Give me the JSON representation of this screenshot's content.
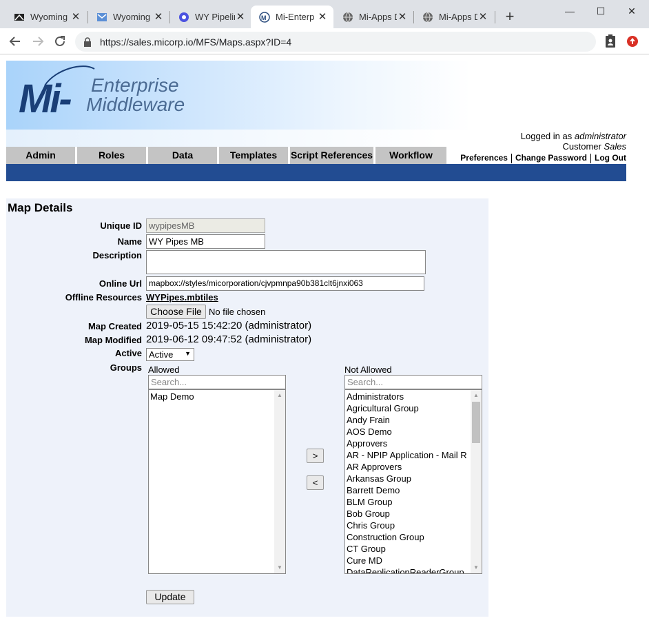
{
  "browser": {
    "tabs": [
      {
        "label": "Wyoming",
        "icon": "wyoming-favicon",
        "active": false
      },
      {
        "label": "Wyoming",
        "icon": "mail-favicon",
        "active": false
      },
      {
        "label": "WY Pipelin",
        "icon": "pipeline-favicon",
        "active": false
      },
      {
        "label": "Mi-Enterp",
        "icon": "mi-favicon",
        "active": true
      },
      {
        "label": "Mi-Apps D",
        "icon": "globe-favicon",
        "active": false
      },
      {
        "label": "Mi-Apps D",
        "icon": "globe-favicon",
        "active": false
      }
    ],
    "window_controls": {
      "minimize": "—",
      "maximize": "☐",
      "close": "✕"
    },
    "url": "https://sales.micorp.io/MFS/Maps.aspx?ID=4"
  },
  "header": {
    "logo_mark": "Mi-",
    "logo_line1": "Enterprise",
    "logo_line2": "Middleware",
    "user_prefix": "Logged in as ",
    "user_name": "administrator",
    "customer_prefix": "Customer ",
    "customer_name": "Sales",
    "links": [
      "Preferences",
      "Change Password",
      "Log Out"
    ],
    "menu": [
      "Admin",
      "Roles",
      "Data",
      "Templates",
      "Script References",
      "Workflow"
    ]
  },
  "form": {
    "title": "Map Details",
    "unique_id_label": "Unique ID",
    "unique_id": "wypipesMB",
    "name_label": "Name",
    "name": "WY Pipes MB",
    "description_label": "Description",
    "description": "",
    "online_url_label": "Online Url",
    "online_url": "mapbox://styles/micorporation/cjvpmnpa90b381clt6jnxi063",
    "offline_label": "Offline Resources",
    "offline_file": "WYPipes.mbtiles",
    "choose_file": "Choose File",
    "no_file": "No file chosen",
    "created_label": "Map Created",
    "created": "2019-05-15 15:42:20 (administrator)",
    "modified_label": "Map Modified",
    "modified": "2019-06-12 09:47:52 (administrator)",
    "active_label": "Active",
    "active_value": "Active",
    "groups_label": "Groups",
    "allowed_header": "Allowed",
    "not_allowed_header": "Not Allowed",
    "search_placeholder": "Search...",
    "allowed": [
      "Map Demo"
    ],
    "not_allowed": [
      "Administrators",
      "Agricultural Group",
      "Andy Frain",
      "AOS Demo",
      "Approvers",
      "AR - NPIP Application - Mail R",
      "AR Approvers",
      "Arkansas Group",
      "Barrett Demo",
      "BLM Group",
      "Bob Group",
      "Chris Group",
      "Construction Group",
      "CT Group",
      "Cure MD",
      "DataReplicationReaderGroup"
    ],
    "move_right": ">",
    "move_left": "<",
    "update": "Update"
  }
}
